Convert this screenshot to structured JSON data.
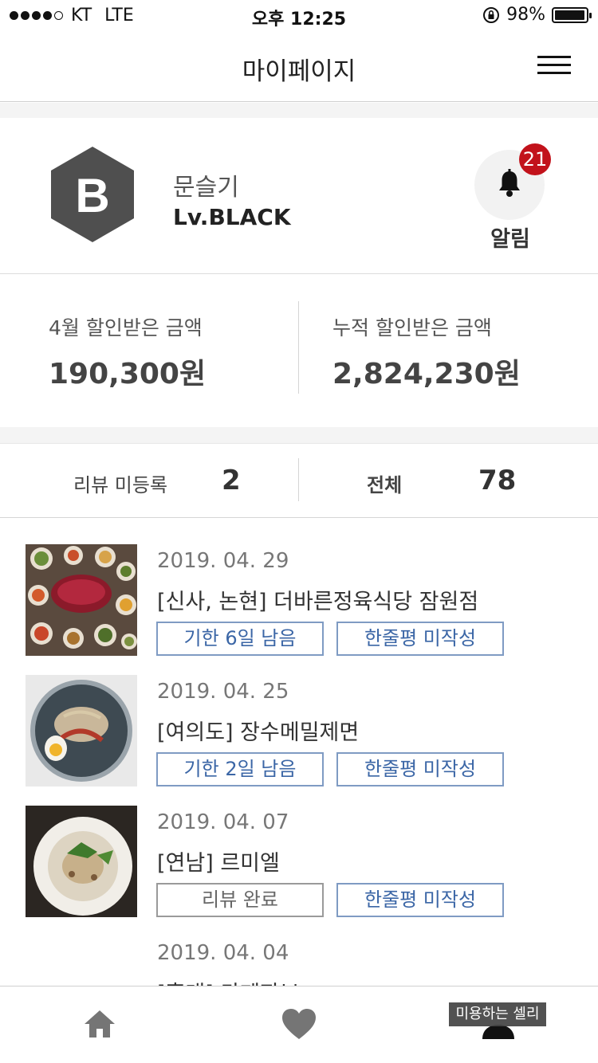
{
  "status_bar": {
    "carrier": "KT",
    "network": "LTE",
    "time": "오후 12:25",
    "battery": "98%",
    "battery_level": 0.98
  },
  "header": {
    "title": "마이페이지"
  },
  "profile": {
    "level_letter": "B",
    "name": "문슬기",
    "level": "Lv.BLACK",
    "notification_count": "21",
    "notification_label": "알림"
  },
  "discounts": {
    "month_label": "4월 할인받은 금액",
    "month_value": "190,300원",
    "total_label": "누적 할인받은 금액",
    "total_value": "2,824,230원"
  },
  "stats": {
    "unreviewed_label": "리뷰 미등록",
    "unreviewed_value": "2",
    "all_label": "전체",
    "all_value": "78"
  },
  "visits": [
    {
      "date": "2019. 04. 29",
      "place": "[신사, 논현] 더바른정육식당 잠원점",
      "status": "기한 6일 남음",
      "comment": "한줄평 미작성"
    },
    {
      "date": "2019. 04. 25",
      "place": "[여의도] 장수메밀제면",
      "status": "기한 2일 남음",
      "comment": "한줄평 미작성"
    },
    {
      "date": "2019. 04. 07",
      "place": "[연남] 르미엘",
      "status": "리뷰 완료",
      "comment": "한줄평 미작성"
    },
    {
      "date": "2019. 04. 04",
      "place": "[홍대] 카페자브"
    }
  ],
  "tabbar": {
    "tooltip": "미용하는 셀리",
    "icons": [
      "home-icon",
      "heart-icon",
      "profile-icon"
    ]
  },
  "colors": {
    "tag_blue": "#3b66a6",
    "badge_red": "#c2121b",
    "hex_gray": "#4f4f4f"
  }
}
